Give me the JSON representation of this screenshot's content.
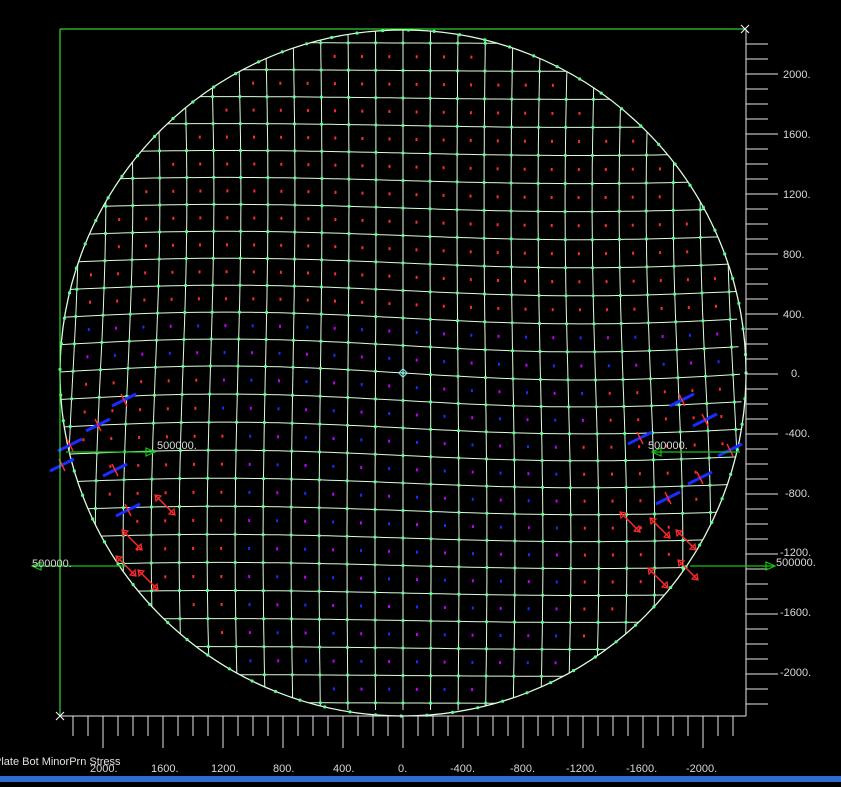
{
  "view": {
    "title": "Plate Bot MinorPrn Stress",
    "background": "#000000",
    "mesh_color": "#dcffdc",
    "node_color": "#5bff9a",
    "load_color": "#16c416",
    "tension_color": "#ff2b2b",
    "compression_color": "#1a2cff",
    "minor_color": "#c000ff",
    "frame_color": "#3cff3c",
    "tick_color": "#e6e6e6",
    "status_bar_color": "#2f6bd0"
  },
  "right_axis": {
    "labels": [
      "2000.",
      "1600.",
      "1200.",
      "800.",
      "400.",
      "0.",
      "-400.",
      "-800.",
      "-1200.",
      "-1600.",
      "-2000."
    ]
  },
  "bottom_axis": {
    "labels": [
      "2000.",
      "1600.",
      "1200.",
      "800.",
      "400.",
      "0.",
      "-400.",
      "-800.",
      "-1200.",
      "-1600.",
      "-2000."
    ]
  },
  "loads": [
    {
      "label": "500000.",
      "direction": "right"
    },
    {
      "label": "500000.",
      "direction": "left"
    },
    {
      "label": "500000.",
      "direction": "left"
    },
    {
      "label": "500000.",
      "direction": "right"
    }
  ]
}
